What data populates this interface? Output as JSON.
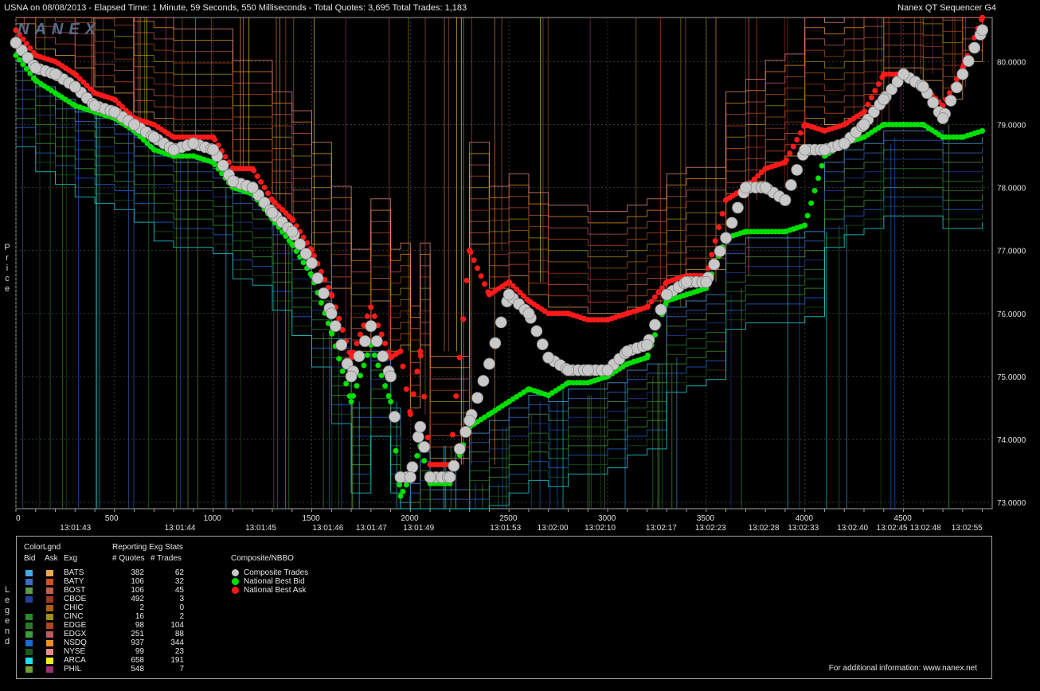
{
  "header": {
    "left": "USNA on 08/08/2013  -  Elapsed Time: 1 Minute, 59 Seconds, 550 Milliseconds  -  Total Quotes: 3,695  Total Trades: 1,183",
    "right": "Nanex QT Sequencer G4"
  },
  "logo": "NANEX",
  "side_labels": {
    "price": "Price",
    "legend": "Legend"
  },
  "chart_data": {
    "type": "line",
    "title": "USNA on 08/08/2013",
    "ylabel": "Price",
    "ylim": [
      72.9,
      80.7
    ],
    "xlim": [
      0,
      4950
    ],
    "y_ticks": [
      "73.0000",
      "74.0000",
      "75.0000",
      "76.0000",
      "77.0000",
      "78.0000",
      "79.0000",
      "80.0000"
    ],
    "y_tick_values": [
      73,
      74,
      75,
      76,
      77,
      78,
      79,
      80
    ],
    "x_ticks": [
      "0",
      "500",
      "1000",
      "1500",
      "2000",
      "2500",
      "3000",
      "3500",
      "4000",
      "4500"
    ],
    "x_tick_values": [
      0,
      500,
      1000,
      1500,
      2000,
      2500,
      3000,
      3500,
      4000,
      4500
    ],
    "time_labels": [
      "13:01:43",
      "13:01:44",
      "13:01:45",
      "13:01:46",
      "13:01:47",
      "13:01:49",
      "13:01:53",
      "13:02:00",
      "13:02:10",
      "13:02:17",
      "13:02:23",
      "13:02:28",
      "13:02:33",
      "13:02:40",
      "13:02:45",
      "13:02:48",
      "13:02:55"
    ],
    "time_label_x": [
      300,
      830,
      1240,
      1580,
      1800,
      2040,
      2480,
      2720,
      2960,
      3270,
      3520,
      3790,
      3990,
      4240,
      4440,
      4610,
      4820
    ],
    "series": [
      {
        "name": "Composite Trades",
        "color": "#c8c8c8",
        "x": [
          0,
          100,
          200,
          300,
          400,
          500,
          600,
          700,
          800,
          900,
          1000,
          1100,
          1200,
          1300,
          1400,
          1500,
          1600,
          1700,
          1800,
          1900,
          1950,
          2000,
          2050,
          2100,
          2200,
          2300,
          2400,
          2500,
          2600,
          2700,
          2800,
          2900,
          3000,
          3100,
          3200,
          3300,
          3400,
          3500,
          3600,
          3700,
          3800,
          3900,
          4000,
          4100,
          4200,
          4300,
          4400,
          4500,
          4600,
          4700,
          4800,
          4900
        ],
        "y": [
          80.3,
          79.9,
          79.8,
          79.6,
          79.3,
          79.2,
          79.0,
          78.8,
          78.6,
          78.7,
          78.6,
          78.1,
          78.0,
          77.6,
          77.3,
          76.8,
          76.0,
          75.0,
          75.8,
          75.0,
          73.4,
          73.4,
          74.2,
          73.4,
          73.4,
          74.3,
          75.2,
          76.3,
          76.0,
          75.3,
          75.1,
          75.1,
          75.1,
          75.4,
          75.5,
          76.3,
          76.5,
          76.5,
          77.2,
          78.0,
          78.0,
          77.8,
          78.6,
          78.6,
          78.7,
          79.0,
          79.4,
          79.8,
          79.6,
          79.1,
          79.8,
          80.5
        ]
      },
      {
        "name": "National Best Bid",
        "color": "#00e000",
        "x": [
          0,
          100,
          200,
          300,
          400,
          500,
          600,
          700,
          800,
          900,
          1000,
          1100,
          1200,
          1300,
          1400,
          1500,
          1600,
          1700,
          1800,
          1900,
          1950,
          2000,
          2050,
          2100,
          2200,
          2300,
          2400,
          2500,
          2600,
          2700,
          2800,
          2900,
          3000,
          3100,
          3200,
          3300,
          3400,
          3500,
          3600,
          3700,
          3800,
          3900,
          4000,
          4100,
          4200,
          4300,
          4400,
          4500,
          4600,
          4700,
          4800,
          4900
        ],
        "y": [
          80.1,
          79.7,
          79.5,
          79.3,
          79.2,
          79.1,
          78.9,
          78.6,
          78.5,
          78.5,
          78.4,
          78.0,
          77.9,
          77.5,
          77.1,
          76.6,
          75.7,
          74.6,
          75.5,
          74.6,
          73.1,
          73.4,
          73.9,
          73.3,
          73.3,
          74.2,
          74.4,
          74.6,
          74.8,
          74.7,
          74.9,
          74.9,
          75.0,
          75.2,
          75.3,
          76.2,
          76.3,
          76.4,
          77.2,
          77.3,
          77.3,
          77.3,
          77.4,
          78.5,
          78.7,
          78.8,
          79.0,
          79.0,
          79.0,
          78.8,
          78.8,
          78.9
        ]
      },
      {
        "name": "National Best Ask",
        "color": "#ff1a1a",
        "x": [
          0,
          100,
          200,
          300,
          400,
          500,
          600,
          700,
          800,
          900,
          1000,
          1100,
          1200,
          1300,
          1400,
          1500,
          1600,
          1700,
          1800,
          1900,
          1950,
          2000,
          2050,
          2100,
          2200,
          2300,
          2400,
          2500,
          2600,
          2700,
          2800,
          2900,
          3000,
          3100,
          3200,
          3300,
          3400,
          3500,
          3600,
          3700,
          3800,
          3900,
          4000,
          4100,
          4200,
          4300,
          4400,
          4500,
          4600,
          4700,
          4800,
          4900
        ],
        "y": [
          80.5,
          80.1,
          80.0,
          79.8,
          79.5,
          79.4,
          79.1,
          79.0,
          78.8,
          78.8,
          78.8,
          78.3,
          78.3,
          77.8,
          77.5,
          77.0,
          76.3,
          75.3,
          76.1,
          75.3,
          75.4,
          74.4,
          75.4,
          73.6,
          73.6,
          77.0,
          76.3,
          76.5,
          76.2,
          76.0,
          76.0,
          75.9,
          75.9,
          76.0,
          76.1,
          76.5,
          76.6,
          76.6,
          77.8,
          78.0,
          78.3,
          78.4,
          79.0,
          78.9,
          79.0,
          79.2,
          79.8,
          79.8,
          79.6,
          79.3,
          79.9,
          80.7
        ]
      }
    ]
  },
  "legend": {
    "headers": {
      "colorlgnd": "ColorLgnd",
      "bid": "Bid",
      "ask": "Ask",
      "exg": "Exg",
      "reporting": "Reporting Exg Stats",
      "quotes": "# Quotes",
      "trades": "# Trades",
      "composite": "Composite/NBBO"
    },
    "rows": [
      {
        "exg": "BATS",
        "quotes": "382",
        "trades": "62",
        "bid_color": "#4aa8e8",
        "ask_color": "#f0a850"
      },
      {
        "exg": "BATY",
        "quotes": "106",
        "trades": "32",
        "bid_color": "#3a6cc8",
        "ask_color": "#d05020"
      },
      {
        "exg": "BOST",
        "quotes": "106",
        "trades": "45",
        "bid_color": "#5a9a48",
        "ask_color": "#c06048"
      },
      {
        "exg": "CBOE",
        "quotes": "492",
        "trades": "3",
        "bid_color": "#2040a0",
        "ask_color": "#a03820"
      },
      {
        "exg": "CHIC",
        "quotes": "2",
        "trades": "0",
        "bid_color": "#000000",
        "ask_color": "#b06010"
      },
      {
        "exg": "CINC",
        "quotes": "16",
        "trades": "2",
        "bid_color": "#2a8a2a",
        "ask_color": "#a09010"
      },
      {
        "exg": "EDGE",
        "quotes": "98",
        "trades": "104",
        "bid_color": "#2a7a2a",
        "ask_color": "#b04818"
      },
      {
        "exg": "EDGX",
        "quotes": "251",
        "trades": "88",
        "bid_color": "#38a038",
        "ask_color": "#c05860"
      },
      {
        "exg": "NSDQ",
        "quotes": "937",
        "trades": "344",
        "bid_color": "#1a6ad8",
        "ask_color": "#f09020"
      },
      {
        "exg": "NYSE",
        "quotes": "99",
        "trades": "23",
        "bid_color": "#1a5a1a",
        "ask_color": "#f08888"
      },
      {
        "exg": "ARCA",
        "quotes": "658",
        "trades": "191",
        "bid_color": "#20e0f0",
        "ask_color": "#f0f020"
      },
      {
        "exg": "PHIL",
        "quotes": "548",
        "trades": "7",
        "bid_color": "#70a030",
        "ask_color": "#a03070"
      }
    ],
    "nbbo": [
      {
        "label": "Composite Trades",
        "color": "#c8c8c8"
      },
      {
        "label": "National Best Bid",
        "color": "#00e000"
      },
      {
        "label": "National Best Ask",
        "color": "#ff1a1a"
      }
    ],
    "footer": "For additional information: www.nanex.net"
  }
}
